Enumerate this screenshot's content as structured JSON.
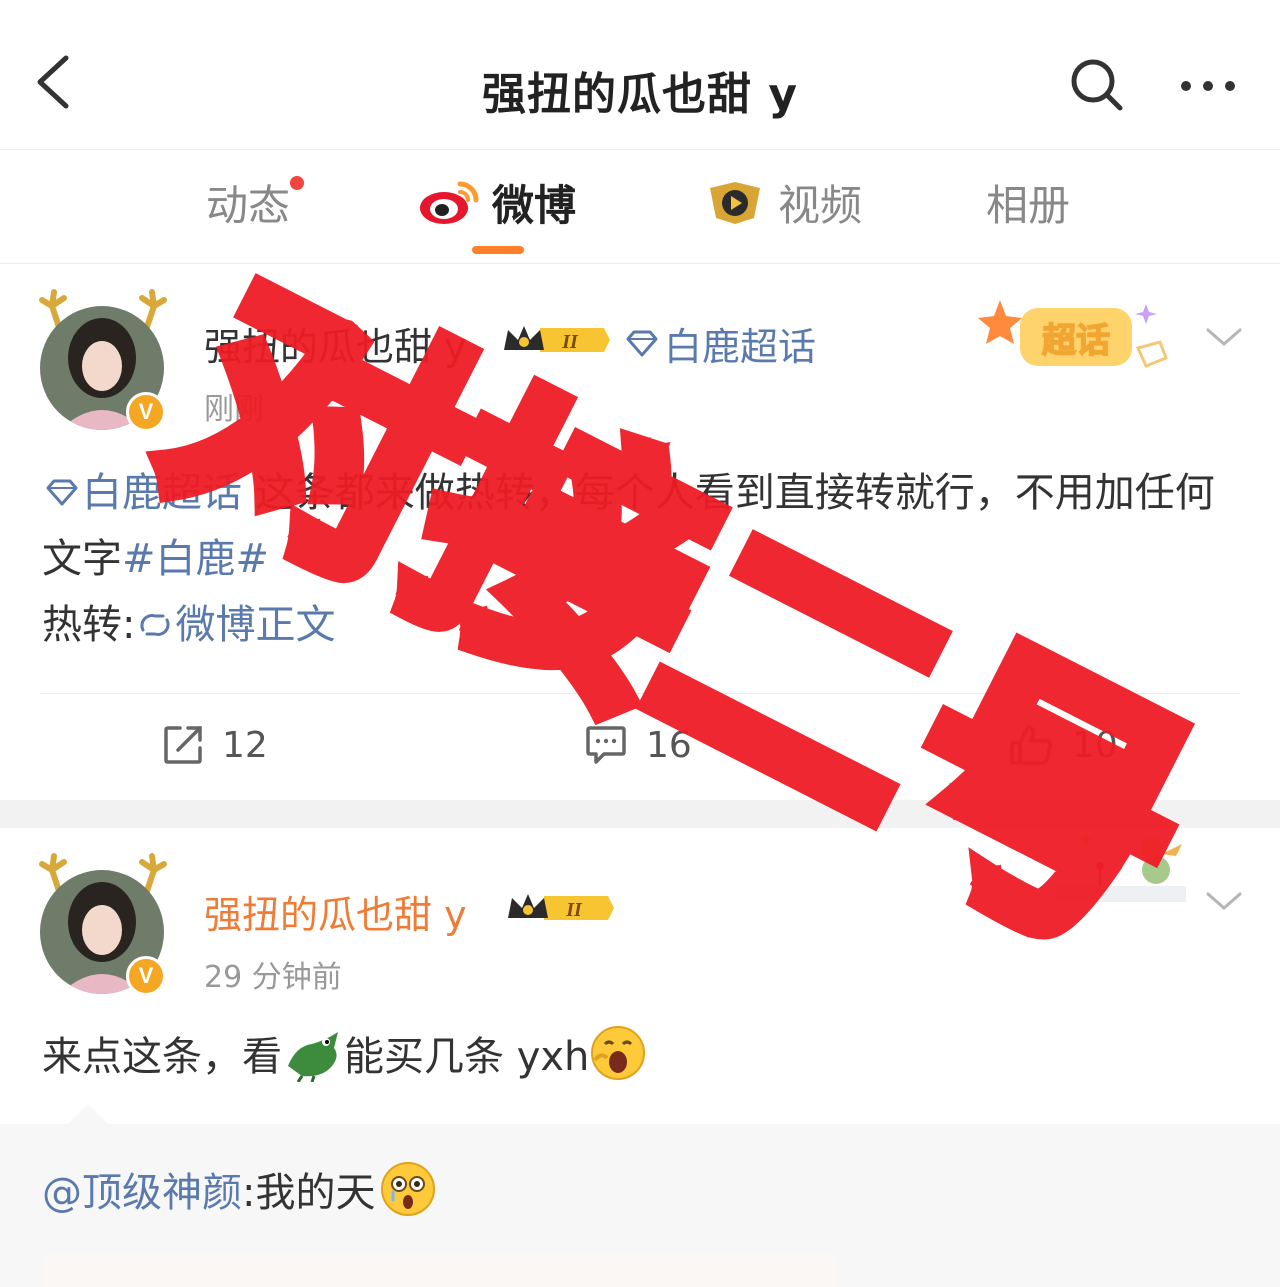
{
  "header": {
    "title": "强扭的瓜也甜 y",
    "back_icon": "back-icon",
    "search_icon": "search-icon",
    "more_icon": "more-icon"
  },
  "tabs": [
    {
      "label": "动态",
      "has_dot": true
    },
    {
      "label": "微博",
      "active": true,
      "icon": "weibo-logo-icon"
    },
    {
      "label": "视频",
      "icon": "video-play-icon"
    },
    {
      "label": "相册"
    }
  ],
  "posts": [
    {
      "author": "强扭的瓜也甜 y",
      "level_badge": "II",
      "topic": "白鹿超话",
      "time": "刚刚",
      "sticker": "超话",
      "text_topic": "白鹿超话",
      "text_main": " 这条都来做热转，每个人看到直接转就行，不用加任何文字",
      "text_hashtag": "#白鹿#",
      "text_line3_prefix": "热转:",
      "text_link": "微博正文",
      "actions": {
        "repost": "12",
        "comment": "16",
        "like": "10"
      }
    },
    {
      "author": "强扭的瓜也甜 y",
      "level_badge": "II",
      "time": "29 分钟前",
      "text_a": "来点这条，看",
      "text_b": "能买几条 yxh",
      "repost_user": "@顶级神颜",
      "repost_text": ":我的天"
    }
  ],
  "watermark": {
    "text": "对接二号",
    "color": "#ee1c25"
  },
  "colors": {
    "accent_orange": "#ff7f2a",
    "link_blue": "#5a7aad",
    "name_orange": "#f07b34",
    "badge_gold": "#f5a623"
  }
}
